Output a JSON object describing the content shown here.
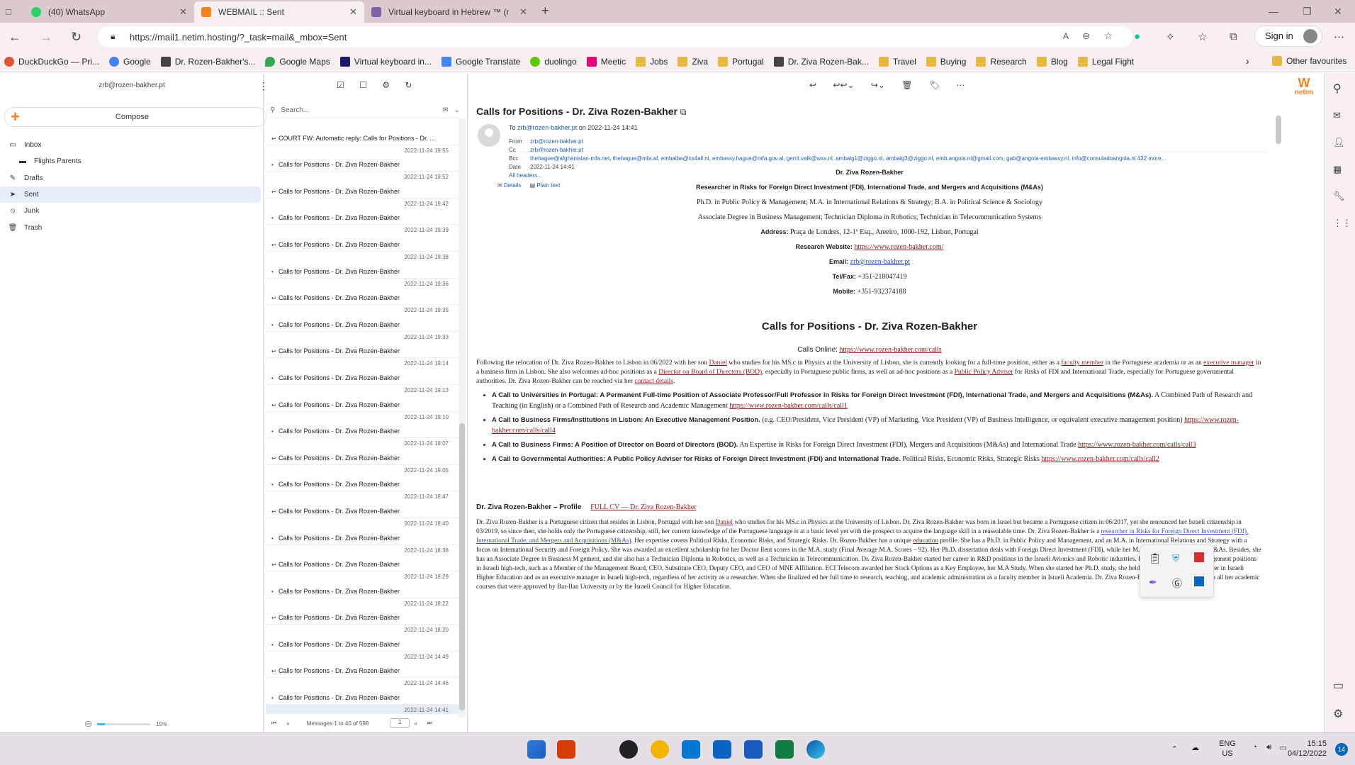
{
  "browser": {
    "tabs": [
      {
        "title": "(40) WhatsApp",
        "color": "#25d366"
      },
      {
        "title": "WEBMAIL :: Sent",
        "color": "#f58220"
      },
      {
        "title": "Virtual keyboard in Hebrew ™ (r",
        "color": "#7b61a8"
      }
    ],
    "url": "https://mail1.netim.hosting/?_task=mail&_mbox=Sent",
    "signin": "Sign in",
    "bookmarks": [
      "DuckDuckGo — Pri...",
      "Google",
      "Dr. Rozen-Bakher's...",
      "Google Maps",
      "Virtual keyboard in...",
      "Google Translate",
      "duolingo",
      "Meetic",
      "Jobs",
      "Ziva",
      "Portugal",
      "Dr. Ziva Rozen-Bak...",
      "Travel",
      "Buying",
      "Research",
      "Blog",
      "Legal Fight"
    ],
    "other_favourites": "Other favourites"
  },
  "mail": {
    "account": "zrb@rozen-bakher.pt",
    "compose": "Compose",
    "folders": [
      "Inbox",
      "Flights Parents",
      "Drafts",
      "Sent",
      "Junk",
      "Trash"
    ],
    "quota": "15%",
    "quota_value": 0.15,
    "search_placeholder": "Search...",
    "messages": [
      {
        "subject": "COURT FW: Automatic reply: Calls for Positions - Dr. ...",
        "date": ""
      },
      {
        "subject": "Calls for Positions - Dr. Ziva Rozen-Bakher",
        "date": "2022-11-24 19:55"
      },
      {
        "subject": "Calls for Positions - Dr. Ziva Rozen-Bakher",
        "date": "2022-11-24 19:52"
      },
      {
        "subject": "Calls for Positions - Dr. Ziva Rozen-Bakher",
        "date": "2022-11-24 19:42"
      },
      {
        "subject": "Calls for Positions - Dr. Ziva Rozen-Bakher",
        "date": "2022-11-24 19:39"
      },
      {
        "subject": "Calls for Positions - Dr. Ziva Rozen-Bakher",
        "date": "2022-11-24 19:38"
      },
      {
        "subject": "Calls for Positions - Dr. Ziva Rozen-Bakher",
        "date": "2022-11-24 19:36"
      },
      {
        "subject": "Calls for Positions - Dr. Ziva Rozen-Bakher",
        "date": "2022-11-24 19:35"
      },
      {
        "subject": "Calls for Positions - Dr. Ziva Rozen-Bakher",
        "date": "2022-11-24 19:33"
      },
      {
        "subject": "Calls for Positions - Dr. Ziva Rozen-Bakher",
        "date": "2022-11-24 19:14"
      },
      {
        "subject": "Calls for Positions - Dr. Ziva Rozen-Bakher",
        "date": "2022-11-24 19:13"
      },
      {
        "subject": "Calls for Positions - Dr. Ziva Rozen-Bakher",
        "date": "2022-11-24 19:10"
      },
      {
        "subject": "Calls for Positions - Dr. Ziva Rozen-Bakher",
        "date": "2022-11-24 19:07"
      },
      {
        "subject": "Calls for Positions - Dr. Ziva Rozen-Bakher",
        "date": "2022-11-24 19:05"
      },
      {
        "subject": "Calls for Positions - Dr. Ziva Rozen-Bakher",
        "date": "2022-11-24 18:47"
      },
      {
        "subject": "Calls for Positions - Dr. Ziva Rozen-Bakher",
        "date": "2022-11-24 18:40"
      },
      {
        "subject": "Calls for Positions - Dr. Ziva Rozen-Bakher",
        "date": "2022-11-24 18:38"
      },
      {
        "subject": "Calls for Positions - Dr. Ziva Rozen-Bakher",
        "date": "2022-11-24 18:29"
      },
      {
        "subject": "Calls for Positions - Dr. Ziva Rozen-Bakher",
        "date": "2022-11-24 18:22"
      },
      {
        "subject": "Calls for Positions - Dr. Ziva Rozen-Bakher",
        "date": "2022-11-24 18:20"
      },
      {
        "subject": "Calls for Positions - Dr. Ziva Rozen-Bakher",
        "date": "2022-11-24 14:49"
      },
      {
        "subject": "Calls for Positions - Dr. Ziva Rozen-Bakher",
        "date": "2022-11-24 14:46"
      },
      {
        "subject": "Calls for Positions - Dr. Ziva Rozen-Bakher",
        "date": "2022-11-24 14:41"
      }
    ],
    "list_footer": "Messages 1 to 40 of 598",
    "page": "1"
  },
  "message": {
    "subject": "Calls for Positions - Dr. Ziva Rozen-Bakher",
    "to_prefix": "To",
    "to": "zrb@rozen-bakher.pt",
    "to_date": "on 2022-11-24 14:41",
    "from_label": "From",
    "from": "zrb@rozen-bakher.pt",
    "cc_label": "Cc",
    "cc": "zrb@rozen-bakher.pt",
    "bcc_label": "Bcc",
    "bcc": "thehague@afghanistan-mfa.net, thehague@mfa.af, embalba@xs4all.nl, embassy.hague@mfa.gov.al, gerrit.valk@wxs.nl, ambalg1@ziggo.nl, ambalg3@ziggo.nl, emb.angola.nl@gmail.com, gab@angola-embassy.nl, info@consuladoangola.nl 432 more...",
    "date_label": "Date",
    "date": "2022-11-24 14:41",
    "all_headers": "All headers...",
    "details": "Details",
    "plain_text": "Plain text",
    "sig": [
      "Dr. Ziva Rozen-Bakher",
      "Researcher in Risks for Foreign Direct Investment (FDI), International Trade, and Mergers and Acquisitions (M&As)",
      "Ph.D. in Public Policy & Management;  M.A. in International Relations & Strategy; B.A. in Political Science & Sociology",
      "Associate Degree in Business Management; Technician Diploma in Robotics; Technician in Telecommunication Systems"
    ],
    "address_label": "Address:",
    "address": "Praça de Londres, 12-1º Esq., Areeiro, 1000-192, Lisbon, Portugal",
    "website_label": "Research Website:",
    "website": "https://www.rozen-bakher.com/",
    "email_label": "Email:",
    "email": "zrb@rozen-bakher.pt",
    "tel_label": "Tel/Fax:",
    "tel": "+351-218047419",
    "mobile_label": "Mobile:",
    "mobile": "+351-932374188",
    "heading": "Calls for Positions - Dr. Ziva Rozen-Bakher",
    "calls_label": "Calls Online:",
    "calls_url": "https://www.rozen-bakher.com/calls",
    "intro_1": "Following the relocation of Dr. Ziva Rozen-Bakher to Lisbon in 06/2022 with her son",
    "intro_daniel": "Daniel",
    "intro_2": "who studies for his MS.c in Physics at the University of Lisbon, she is currently looking for a full-time position, either as a",
    "intro_faculty": "faculty member",
    "intro_3": "in the Portuguese academia or as an",
    "intro_exec": "executive manager",
    "intro_4": "in a business firm in Lisbon. She also welcomes ad-hoc positions as a",
    "intro_board": "Director on Board of Directors (BOD)",
    "intro_5": ", especially in Portuguese public firms, as well as ad-hoc positions as a",
    "intro_policy": "Public Policy Adviser",
    "intro_6": "for Risks of FDI and International Trade, especially for Portuguese governmental authorities. Dr. Ziva Rozen-Bakher can be reached via her",
    "intro_contact": "contact details",
    "intro_7": ".",
    "calls": [
      {
        "bold": "A Call to Universities in Portugal: A Permanent Full-time Position of Associate Professor/Full Professor in Risks for Foreign Direct Investment (FDI), International Trade, and Mergers and Acquisitions (M&As).",
        "text": "A Combined Path of Research and Teaching (in English) or a Combined Path of Research and Academic Management",
        "url": "https://www.rozen-bakher.com/calls/call1"
      },
      {
        "bold": "A Call to Business Firms/Institutions in Lisbon: An Executive Management Position.",
        "text": "(e.g. CEO/President, Vice President (VP) of Marketing, Vice President (VP) of Business Intelligence, or equivalent executive management position)",
        "url": "https://www.rozen-bakher.com/calls/call4"
      },
      {
        "bold": "A Call to Business Firms: A Position of Director on Board of Directors (BOD).",
        "text": "An Expertise in Risks for Foreign Direct Investment (FDI), Mergers and Acquisitions (M&As) and International Trade",
        "url": "https://www.rozen-bakher.com/calls/call3"
      },
      {
        "bold": "A Call to Governmental Authorities: A Public Policy Adviser for Risks of Foreign Direct Investment (FDI) and International Trade.",
        "text": "Political Risks, Economic Risks, Strategic Risks",
        "url": "https://www.rozen-bakher.com/calls/call2"
      }
    ],
    "profile_heading": "Dr. Ziva Rozen-Bakher – Profile",
    "profile_cv": "FULL CV — Dr. Ziva Rozen-Bakher",
    "profile_1": "Dr. Ziva Rozen-Bakher is a Portuguese citizen that resides in Lisbon, Portugal with her son",
    "profile_daniel": "Daniel",
    "profile_2": "who studies for his MS.c in Physics at the University of Lisbon. Dr. Ziva Rozen-Bakher was born in Israel but became a Portuguese citizen in 06/2017, yet she renounced her Israeli citizenship in 03/2019, so since then, she holds only the Portuguese citizenship, still, her current knowledge of the Portuguese language is at a basic level yet with the prospect to acquire the language skill in a reasealable time. Dr. Ziva Rozen-Bakher is a",
    "profile_researcher": "researcher in Risks for Foreign Direct Investment (FDI), International Trade, and Mergers and Acquisitions (M&As)",
    "profile_3": ". Her expertise covers Political Risks, Economic Risks, and Strategic Risks. Dr. Rozen-Bakher has a unique",
    "profile_education": "education",
    "profile_4": "profile. She has a Ph.D. in Public Policy and Management, and an M.A. in International Relations and Strategy with a focus on International Security and Foreign Policy. She was awarded an excellent scholarship for her Doctor",
    "profile_4b": "llent scores in the M.A. study (Final Average M.A. Scores – 92). Her Ph.D. dissertation deals with Foreign Direct Investment (FDI), while her M.A. dissertation deals with M&As. Besides, she has an Associate Degree in Business M",
    "profile_4c": "gement, and she also has a Technician Diploma in Robotics, as well as a Technician in Telecommunication. Dr. Ziva Rozen-Bakher started her career in R&D positions in the Israeli Avionics and Robotic industries. Following that, fo",
    "profile_4d": "tive management positions in Israeli high-tech, such as a Member of the Management Board, CEO, Substitute CEO, Deputy CEO, and CEO of MNE Affiliation. ECI Telecom awarded her Stock Options as a Key Employee,",
    "profile_4e": "her M.A Study. When she started her Ph.D. study, she held parallel positions as a lecturer in Israeli Higher Education and as an executive manager in Israeli high-tech, regardless of her activity as a researcher. When she finalized",
    "profile_4f": "ed her full time to research, teaching, and academic administration as a faculty member in Israeli Academia. Dr. Ziva Rozen-Bakher developed on her own all her academic courses that were approved by Bar-Ilan University or by the Israeli Council for Higher Education."
  },
  "taskbar": {
    "lang": "ENG",
    "region": "US",
    "time": "15:15",
    "date": "04/12/2022",
    "notif": "14"
  },
  "brand": {
    "name": "netim",
    "color": "#f58220"
  }
}
